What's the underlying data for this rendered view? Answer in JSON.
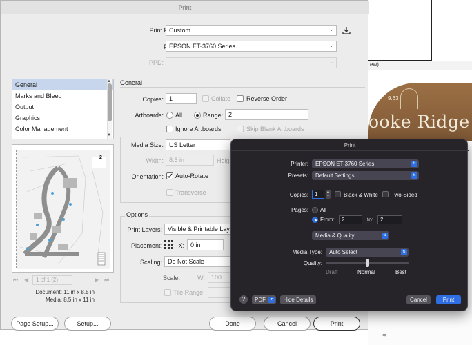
{
  "background_doc": {
    "tab_fragment": "ew)",
    "art_number": "9.63",
    "art_text": "ooke Ridge",
    "side_ruler_text": "8"
  },
  "main_dialog": {
    "title": "Print",
    "print_preset_label": "Print Preset:",
    "print_preset_value": "Custom",
    "printer_label": "Printer:",
    "printer_value": "EPSON ET-3760 Series",
    "ppd_label": "PPD:",
    "categories": [
      "General",
      "Marks and Bleed",
      "Output",
      "Graphics",
      "Color Management"
    ],
    "section_general": "General",
    "copies_label": "Copies:",
    "copies_value": "1",
    "collate_label": "Collate",
    "reverse_order_label": "Reverse Order",
    "artboards_label": "Artboards:",
    "all_label": "All",
    "range_label": "Range:",
    "range_value": "2",
    "ignore_artboards_label": "Ignore Artboards",
    "skip_blank_label": "Skip Blank Artboards",
    "media_size_label": "Media Size:",
    "media_size_value": "US Letter",
    "width_label": "Width:",
    "width_value": "8.5 in",
    "height_label_fragment": "Heig",
    "orientation_label": "Orientation:",
    "auto_rotate_label": "Auto-Rotate",
    "transverse_label": "Transverse",
    "options_title": "Options",
    "print_layers_label": "Print Layers:",
    "print_layers_value": "Visible & Printable Lay",
    "placement_label": "Placement:",
    "x_label": "X:",
    "x_value": "0 in",
    "scaling_label": "Scaling:",
    "scaling_value": "Do Not Scale",
    "scale_label": "Scale:",
    "w_label": "W:",
    "w_value": "100",
    "tile_range_label": "Tile Range:",
    "preview_page_number": "2",
    "page_nav": "1 of 1 (2)",
    "document_size": "Document: 11 in x 8.5 in",
    "media_size_info": "Media: 8.5 in x 11 in",
    "buttons": {
      "page_setup": "Page Setup...",
      "setup": "Setup...",
      "done": "Done",
      "cancel": "Cancel",
      "print": "Print"
    }
  },
  "mac_dialog": {
    "title": "Print",
    "printer_label": "Printer:",
    "printer_value": "EPSON ET-3760 Series",
    "presets_label": "Presets:",
    "presets_value": "Default Settings",
    "copies_label": "Copies:",
    "copies_value": "1",
    "bw_label": "Black & White",
    "two_sided_label": "Two-Sided",
    "pages_label": "Pages:",
    "all_label": "All",
    "from_label": "From:",
    "from_value": "2",
    "to_label": "to:",
    "to_value": "2",
    "section_value": "Media & Quality",
    "media_type_label": "Media Type:",
    "media_type_value": "Auto Select",
    "quality_label": "Quality:",
    "quality_ticks": [
      "Draft",
      "Normal",
      "Best"
    ],
    "quality_level": "Normal",
    "help_label": "?",
    "pdf_label": "PDF",
    "hide_details_label": "Hide Details",
    "cancel_label": "Cancel",
    "print_label": "Print"
  }
}
